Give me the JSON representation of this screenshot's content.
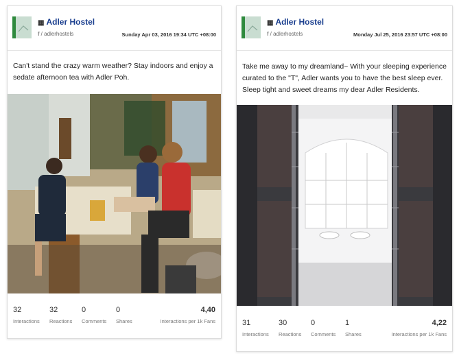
{
  "colors": {
    "page_name": "#1b3f8f",
    "logo_green": "#2f8a3e"
  },
  "posts": [
    {
      "page_name": "Adler Hostel",
      "page_icon": "building-icon",
      "handle": "/ adlerhostels",
      "date": "Sunday Apr 03, 2016 19:34 UTC +08:00",
      "message": "Can't stand the crazy warm weather? Stay indoors and enjoy a sedate afternoon tea with Adler Poh.",
      "stats": {
        "interactions": "32",
        "interactions_label": "Interactions",
        "reactions": "32",
        "reactions_label": "Reactions",
        "comments": "0",
        "comments_label": "Comments",
        "shares": "0",
        "shares_label": "Shares",
        "per_fans": "4,40",
        "per_fans_label": "Interactions per 1k Fans"
      }
    },
    {
      "page_name": "Adler Hostel",
      "page_icon": "building-icon",
      "handle": "/ adlerhostels",
      "date": "Monday Jul 25, 2016 23:57 UTC +08:00",
      "message": "Take me away to my dreamland~ With your sleeping experience curated to the \"T\", Adler wants you to have the best sleep ever. Sleep tight and sweet dreams my dear Adler Residents.",
      "stats": {
        "interactions": "31",
        "interactions_label": "Interactions",
        "reactions": "30",
        "reactions_label": "Reactions",
        "comments": "0",
        "comments_label": "Comments",
        "shares": "1",
        "shares_label": "Shares",
        "per_fans": "4,22",
        "per_fans_label": "Interactions per 1k Fans"
      }
    }
  ]
}
